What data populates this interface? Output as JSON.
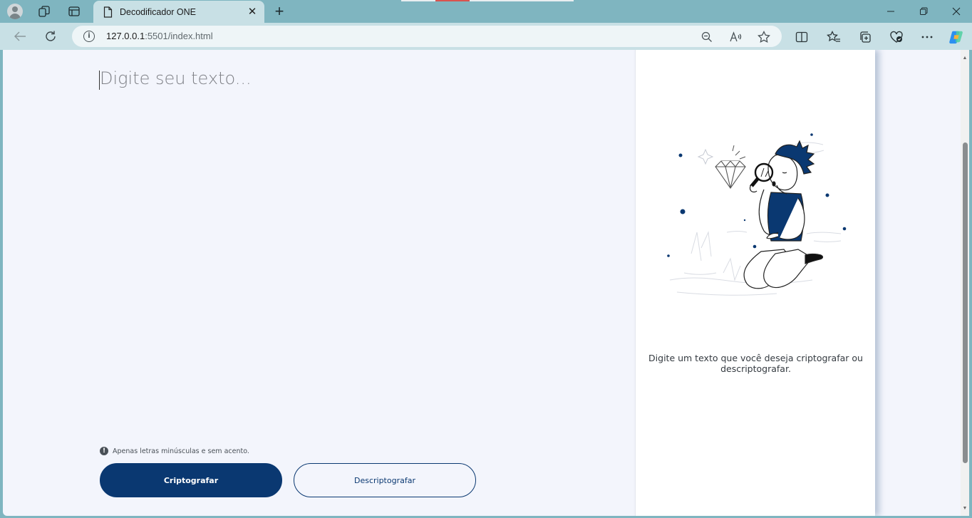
{
  "browser": {
    "tab_title": "Decodificador ONE",
    "url_host": "127.0.0.1",
    "url_rest": ":5501/index.html"
  },
  "app": {
    "input_placeholder": "Digite seu texto...",
    "hint": "Apenas letras minúsculas e sem acento.",
    "encrypt_label": "Criptografar",
    "decrypt_label": "Descriptografar",
    "empty_message": "Digite um texto que você deseja criptografar ou descriptografar."
  },
  "colors": {
    "primary": "#0a3871",
    "background": "#f3f5fc",
    "browser_frame": "#7fb5c0"
  }
}
